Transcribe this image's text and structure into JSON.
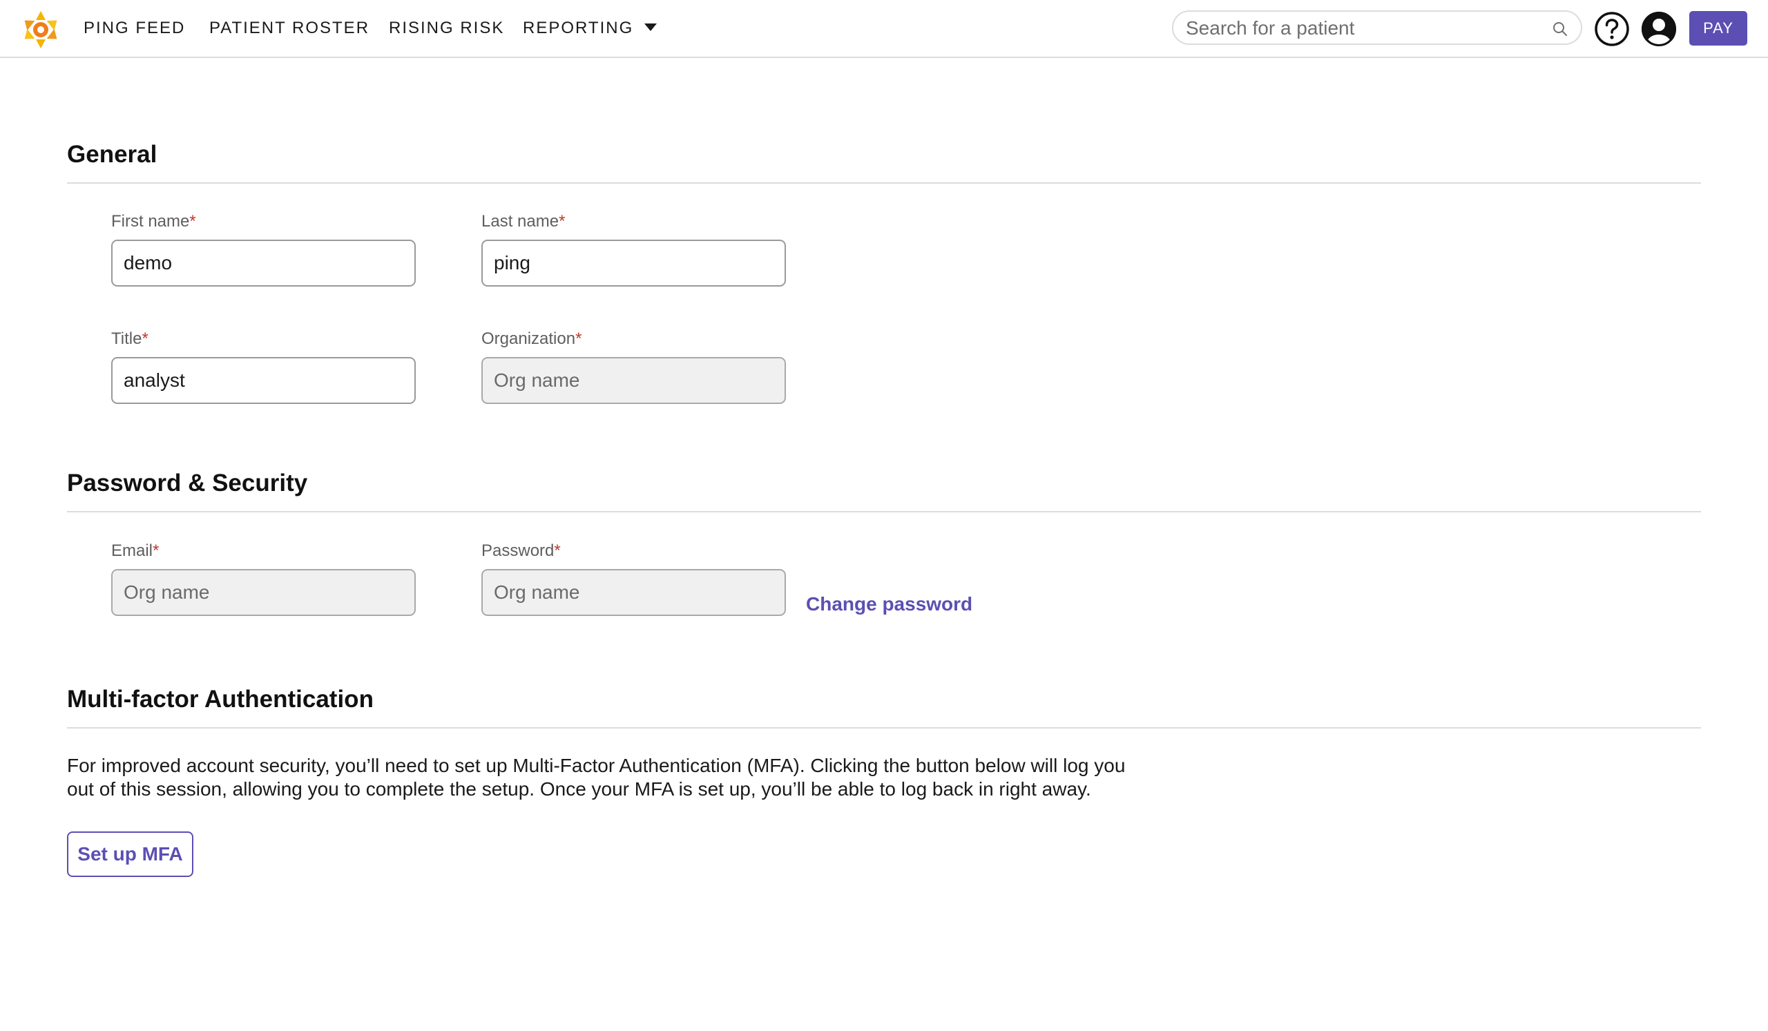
{
  "nav": {
    "logo": "ping-logo",
    "items": [
      {
        "label": "PING FEED"
      },
      {
        "label": "PATIENT ROSTER"
      },
      {
        "label": "RISING RISK"
      },
      {
        "label": "REPORTING"
      }
    ],
    "search_placeholder": "Search for a patient",
    "pay_label": "PAY",
    "icons": {
      "search": "search-icon",
      "help": "help-icon",
      "user": "user-icon",
      "dropdown": "caret-down-icon"
    }
  },
  "general": {
    "title": "General",
    "first_name": {
      "label": "First name",
      "value": "demo"
    },
    "last_name": {
      "label": "Last name",
      "value": "ping"
    },
    "title_field": {
      "label": "Title",
      "value": "analyst"
    },
    "organization": {
      "label": "Organization",
      "placeholder": "Org name"
    }
  },
  "security": {
    "title": "Password & Security",
    "email": {
      "label": "Email",
      "placeholder": "Org name"
    },
    "password": {
      "label": "Password",
      "placeholder": "Org name"
    },
    "change_password": "Change password"
  },
  "mfa": {
    "title": "Multi-factor Authentication",
    "description_line1": "For improved account security, you’ll need to set up Multi-Factor Authentication (MFA). Clicking the button below will log you",
    "description_line2": "out of this session, allowing you to complete the setup. Once your MFA is set up, you’ll be able to log back in right away.",
    "button_label": "Set up MFA"
  },
  "required_marker": "*",
  "colors": {
    "accent": "#5b4fb3",
    "required": "#c0392b",
    "logo_yellow": "#f5b400",
    "logo_orange": "#ef7d1a"
  }
}
